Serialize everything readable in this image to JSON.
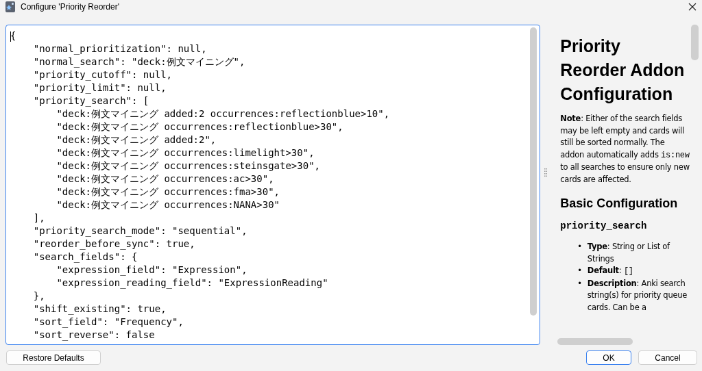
{
  "window": {
    "title": "Configure 'Priority Reorder'"
  },
  "editor": {
    "lines": [
      "{",
      "    \"normal_prioritization\": null,",
      "    \"normal_search\": \"deck:例文マイニング\",",
      "    \"priority_cutoff\": null,",
      "    \"priority_limit\": null,",
      "    \"priority_search\": [",
      "        \"deck:例文マイニング added:2 occurrences:reflectionblue>10\",",
      "        \"deck:例文マイニング occurrences:reflectionblue>30\",",
      "        \"deck:例文マイニング added:2\",",
      "        \"deck:例文マイニング occurrences:limelight>30\",",
      "        \"deck:例文マイニング occurrences:steinsgate>30\",",
      "        \"deck:例文マイニング occurrences:ac>30\",",
      "        \"deck:例文マイニング occurrences:fma>30\",",
      "        \"deck:例文マイニング occurrences:NANA>30\"",
      "    ],",
      "    \"priority_search_mode\": \"sequential\",",
      "    \"reorder_before_sync\": true,",
      "    \"search_fields\": {",
      "        \"expression_field\": \"Expression\",",
      "        \"expression_reading_field\": \"ExpressionReading\"",
      "    },",
      "    \"shift_existing\": true,",
      "    \"sort_field\": \"Frequency\",",
      "    \"sort_reverse\": false"
    ]
  },
  "help": {
    "title": "Priority Reorder Addon Configuration",
    "note": [
      {
        "kind": "bold",
        "text": "Note"
      },
      {
        "kind": "text",
        "text": ": Either of the search fields may be left empty and cards will still be sorted normally. The addon automatically adds "
      },
      {
        "kind": "code",
        "text": "is:new"
      },
      {
        "kind": "text",
        "text": " to all searches to ensure only new cards are affected."
      }
    ],
    "section": "Basic Configuration",
    "option": "priority_search",
    "items": [
      {
        "marker": "•",
        "runs": [
          {
            "kind": "bold",
            "text": "Type"
          },
          {
            "kind": "text",
            "text": ": String or List of Strings"
          }
        ]
      },
      {
        "marker": "•",
        "runs": [
          {
            "kind": "bold",
            "text": "Default"
          },
          {
            "kind": "text",
            "text": ": "
          },
          {
            "kind": "code",
            "text": "[]"
          }
        ]
      },
      {
        "marker": "•",
        "runs": [
          {
            "kind": "bold",
            "text": "Description"
          },
          {
            "kind": "text",
            "text": ": Anki search string(s) for priority queue cards. Can be a"
          }
        ]
      }
    ]
  },
  "buttons": [
    {
      "label": "Restore Defaults",
      "default": false
    },
    {
      "label": "OK",
      "default": true
    },
    {
      "label": "Cancel",
      "default": false
    }
  ]
}
